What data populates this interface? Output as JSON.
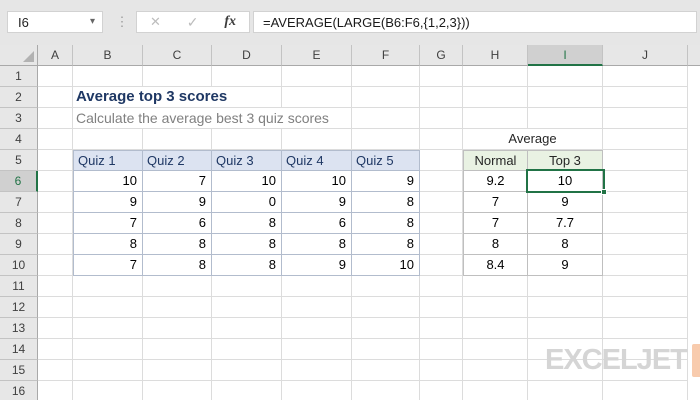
{
  "formula_bar": {
    "cell_reference": "I6",
    "formula": "=AVERAGE(LARGE(B6:F6,{1,2,3}))",
    "fx_label": "fx",
    "cancel_glyph": "✕",
    "enter_glyph": "✓",
    "dropdown_glyph": "▾",
    "separator_glyph": "⋮"
  },
  "sheet": {
    "column_headers": [
      "A",
      "B",
      "C",
      "D",
      "E",
      "F",
      "G",
      "H",
      "I",
      "J"
    ],
    "row_headers": [
      "1",
      "2",
      "3",
      "4",
      "5",
      "6",
      "7",
      "8",
      "9",
      "10",
      "11",
      "12",
      "13",
      "14",
      "15",
      "16"
    ],
    "selected_column": "I",
    "selected_row": "6",
    "selected_cell": "I6"
  },
  "content": {
    "title": "Average top 3 scores",
    "subtitle": "Calculate the average best 3 quiz scores",
    "quiz_table": {
      "headers": [
        "Quiz 1",
        "Quiz 2",
        "Quiz 3",
        "Quiz 4",
        "Quiz 5"
      ],
      "rows": [
        [
          10,
          7,
          10,
          10,
          9
        ],
        [
          9,
          9,
          0,
          9,
          8
        ],
        [
          7,
          6,
          8,
          6,
          8
        ],
        [
          8,
          8,
          8,
          8,
          8
        ],
        [
          7,
          8,
          8,
          9,
          10
        ]
      ]
    },
    "average_table": {
      "label": "Average",
      "headers": [
        "Normal",
        "Top 3"
      ],
      "rows": [
        [
          "9.2",
          "10"
        ],
        [
          "7",
          "9"
        ],
        [
          "7",
          "7.7"
        ],
        [
          "8",
          "8"
        ],
        [
          "8.4",
          "9"
        ]
      ]
    }
  },
  "logo": {
    "text": "EXCELJET"
  },
  "colors": {
    "accent_green": "#217346",
    "quiz_header_fill": "#dce3f1",
    "avg_header_fill": "#e9f2e3",
    "title_color": "#1f3864",
    "subtitle_color": "#808080",
    "logo_orange": "#f8cbad"
  }
}
